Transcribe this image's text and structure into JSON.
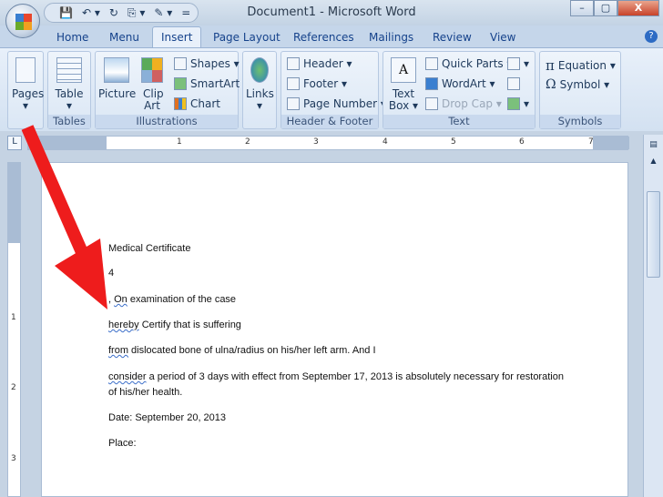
{
  "window": {
    "title": "Document1 - Microsoft Word",
    "minimize": "–",
    "maximize": "▢",
    "close": "X"
  },
  "qat": [
    "💾",
    "↶ ▾",
    "↻",
    "⎘ ▾",
    "✎ ▾",
    "="
  ],
  "tabs": [
    "Home",
    "Menu",
    "Insert",
    "Page Layout",
    "References",
    "Mailings",
    "Review",
    "View"
  ],
  "help": "?",
  "ribbon": {
    "pages": {
      "label": "Pages"
    },
    "tables": {
      "table": "Table",
      "group": "Tables"
    },
    "illustrations": {
      "picture": "Picture",
      "clip_art": "Clip Art",
      "shapes": "Shapes ▾",
      "smartart": "SmartArt",
      "chart": "Chart",
      "group": "Illustrations"
    },
    "links": {
      "label": "Links"
    },
    "header_footer": {
      "header": "Header ▾",
      "footer": "Footer ▾",
      "page_number": "Page Number ▾",
      "group": "Header & Footer"
    },
    "text": {
      "text_box": "Text Box ▾",
      "quick_parts": "Quick Parts ▾",
      "wordart": "WordArt ▾",
      "drop_cap": "Drop Cap ▾",
      "group": "Text"
    },
    "symbols": {
      "equation": "Equation ▾",
      "symbol": "Symbol ▾",
      "pi": "π",
      "omega": "Ω",
      "group": "Symbols"
    }
  },
  "ruler": {
    "numbers": [
      "1",
      "2",
      "3",
      "4",
      "5",
      "6",
      "7"
    ],
    "vnumbers": [
      "1",
      "2",
      "3"
    ]
  },
  "document": {
    "lines": [
      {
        "text": "Medical Certificate"
      },
      {
        "text": "4"
      },
      {
        "pre": ", ",
        "sq": "On",
        "text": " examination of the case"
      },
      {
        "sq": "hereby",
        "text": " Certify that is suffering"
      },
      {
        "sq": "from",
        "text": " dislocated bone of ulna/radius on his/her left arm. And I"
      },
      {
        "sq": "consider",
        "text": " a period of 3 days with effect from September 17, 2013 is absolutely necessary for restoration"
      },
      {
        "text": "of his/her health."
      },
      {
        "text": "Date: September 20, 2013"
      },
      {
        "text": "Place:"
      }
    ]
  },
  "colors": {
    "arrow": "#ee1c1c"
  }
}
